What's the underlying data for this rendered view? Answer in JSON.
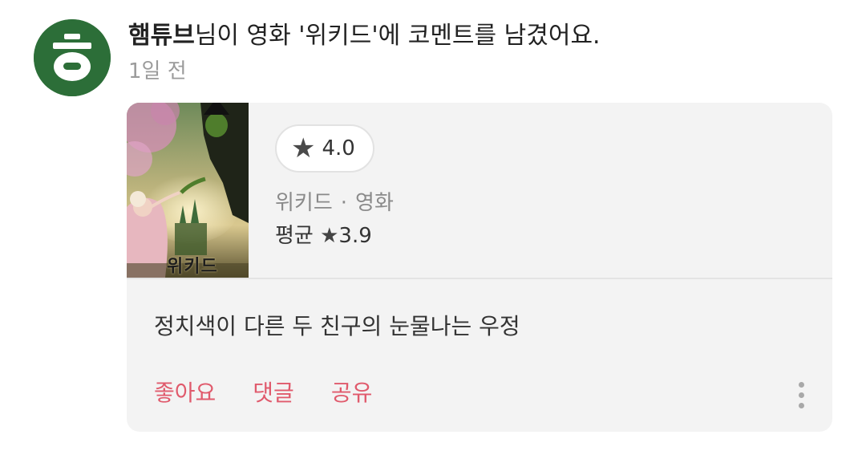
{
  "activity": {
    "user_name": "햄튜브",
    "message_rest": "님이 영화 '위키드'에 코멘트를 남겼어요.",
    "timestamp": "1일 전",
    "avatar_icon": "hieut-letter-icon",
    "avatar_color": "#2c6e38"
  },
  "movie": {
    "poster_title": "위키드",
    "my_rating": "4.0",
    "title": "위키드",
    "category": "영화",
    "separator": "·",
    "average_label": "평균",
    "average_star": "★",
    "average_value": "3.9",
    "rating_star": "★"
  },
  "comment": {
    "text": "정치색이 다른 두 친구의 눈물나는 우정"
  },
  "actions": {
    "like_label": "좋아요",
    "reply_label": "댓글",
    "share_label": "공유",
    "accent_color": "#e05a6c",
    "more_icon": "more-vertical-icon"
  }
}
